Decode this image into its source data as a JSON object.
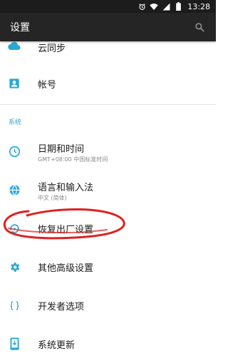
{
  "status_bar": {
    "time": "13:28",
    "icons": [
      "alarm-icon",
      "wifi-icon",
      "signal-icon",
      "battery-icon"
    ]
  },
  "app_bar": {
    "title": "设置",
    "search_icon": "search-icon"
  },
  "items": [
    {
      "title": "云同步",
      "icon": "cloud-icon"
    },
    {
      "title": "帐号",
      "icon": "account-icon"
    }
  ],
  "section_system": {
    "header": "系统",
    "items": [
      {
        "title": "日期和时间",
        "summary": "GMT+08:00 中国标准时间",
        "icon": "clock-icon"
      },
      {
        "title": "语言和输入法",
        "summary": "中文 (简体)",
        "icon": "globe-icon"
      },
      {
        "title": "恢复出厂设置",
        "icon": "restore-icon"
      },
      {
        "title": "其他高级设置",
        "icon": "gear-icon"
      },
      {
        "title": "开发者选项",
        "icon": "code-braces-icon"
      },
      {
        "title": "系统更新",
        "icon": "phone-update-icon"
      }
    ]
  },
  "colors": {
    "accent": "#2ba8d6",
    "annotation": "#e0201f",
    "app_bar": "#252525",
    "status_bar": "#1c1c1c"
  }
}
